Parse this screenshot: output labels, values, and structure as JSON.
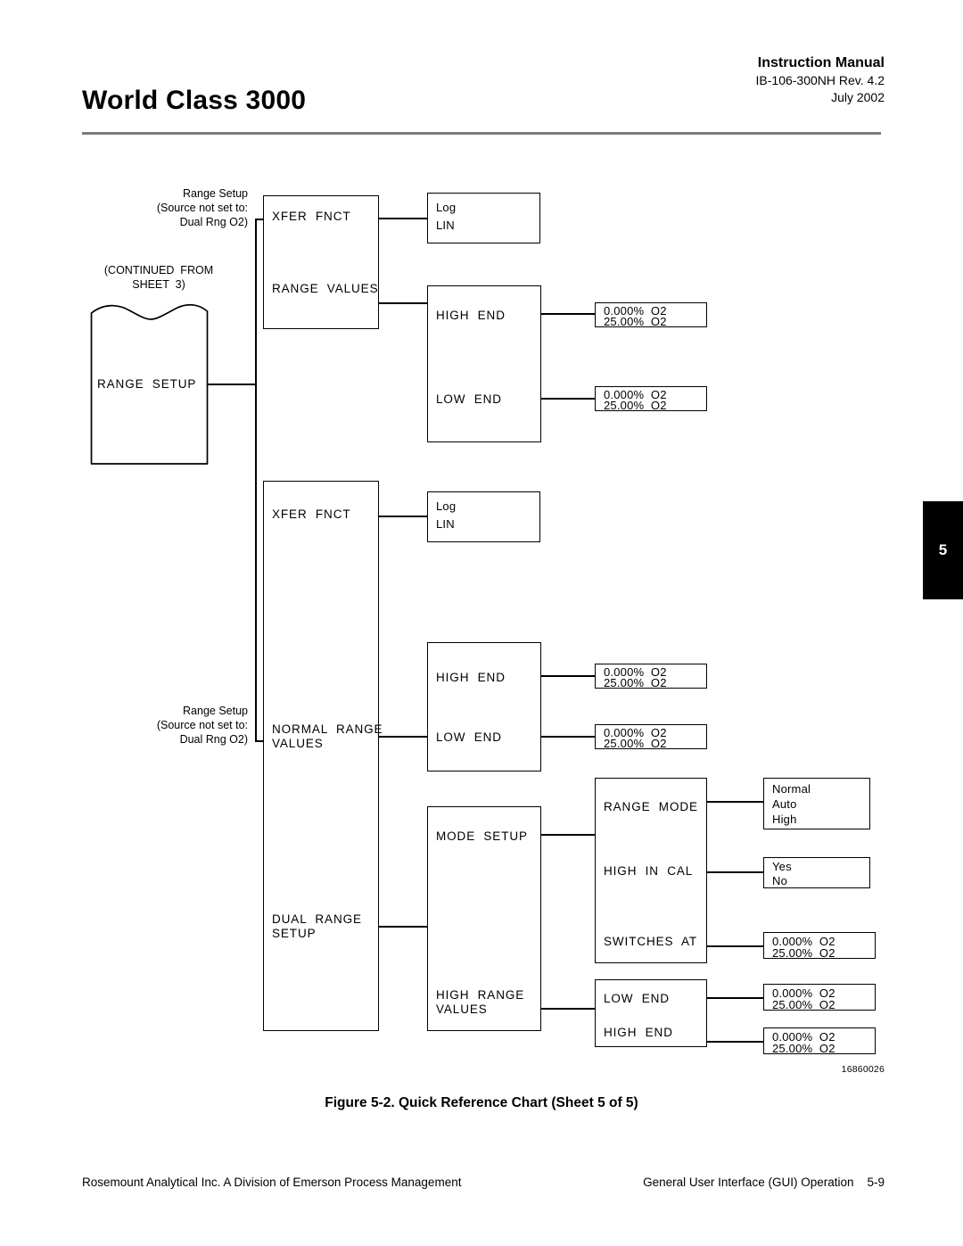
{
  "header": {
    "doc_title": "World Class 3000",
    "manual_label": "Instruction Manual",
    "manual_number": "IB-106-300NH Rev. 4.2",
    "manual_date": "July 2002"
  },
  "side_tab": {
    "chapter": "5"
  },
  "notes": {
    "continued_from": "(CONTINUED  FROM\nSHEET  3)",
    "range_setup_source_top": "Range Setup\n(Source not set to:\nDual Rng O2)",
    "range_setup_source_bottom": "Range Setup\n(Source not set to:\nDual Rng O2)"
  },
  "diagram": {
    "root": {
      "label": "RANGE  SETUP"
    },
    "branch_single": {
      "menu": {
        "items": [
          "XFER  FNCT",
          "RANGE  VALUES"
        ]
      },
      "xfer_options": [
        "Log",
        "LIN"
      ],
      "range_values": {
        "items": [
          "HIGH  END",
          "LOW  END"
        ]
      },
      "high_end_values": [
        "0.000%  O2",
        "25.00%  O2"
      ],
      "low_end_values": [
        "0.000%  O2",
        "25.00%  O2"
      ]
    },
    "branch_dual": {
      "menu": {
        "items": [
          "XFER  FNCT",
          "NORMAL  RANGE\nVALUES",
          "DUAL  RANGE\nSETUP"
        ]
      },
      "xfer_options": [
        "Log",
        "LIN"
      ],
      "normal_range_values": {
        "items": [
          "HIGH  END",
          "LOW  END"
        ]
      },
      "normal_high_end_values": [
        "0.000%  O2",
        "25.00%  O2"
      ],
      "normal_low_end_values": [
        "0.000%  O2",
        "25.00%  O2"
      ],
      "dual_range_menu": {
        "items": [
          "MODE  SETUP",
          "HIGH  RANGE\nVALUES"
        ]
      },
      "mode_setup": {
        "items": [
          "RANGE  MODE",
          "HIGH  IN  CAL",
          "SWITCHES  AT"
        ]
      },
      "range_mode_options": [
        "Normal",
        "Auto",
        "High"
      ],
      "high_in_cal_options": [
        "Yes",
        "No"
      ],
      "switches_at_values": [
        "0.000%  O2",
        "25.00%  O2"
      ],
      "high_range_values": {
        "items": [
          "LOW  END",
          "HIGH  END"
        ]
      },
      "high_range_low_end_values": [
        "0.000%  O2",
        "25.00%  O2"
      ],
      "high_range_high_end_values": [
        "0.000%  O2",
        "25.00%  O2"
      ]
    },
    "drawing_number": "16860026"
  },
  "figure": {
    "caption": "Figure 5-2.  Quick Reference Chart (Sheet 5 of 5)"
  },
  "footer": {
    "left": "Rosemount Analytical Inc.    A Division of Emerson Process Management",
    "right": "General User Interface (GUI) Operation    5-9"
  }
}
